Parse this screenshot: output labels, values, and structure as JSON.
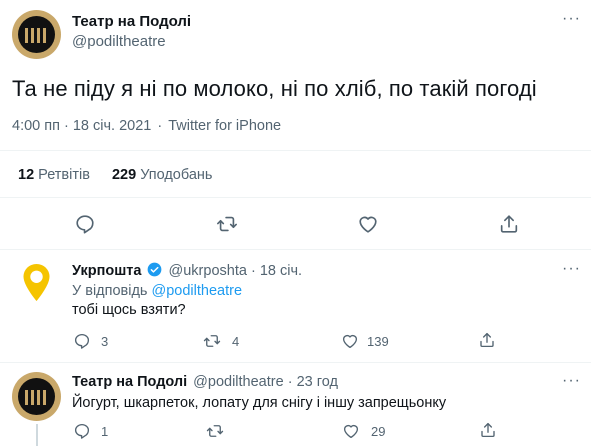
{
  "main_tweet": {
    "display_name": "Театр на Подолі",
    "handle": "@podiltheatre",
    "text": "Та не піду я ні по молоко, ні по хліб, по такій погоді",
    "timestamp": "4:00 пп · 18 січ. 2021",
    "separator": "·",
    "source": "Twitter for iPhone",
    "retweets_count": "12",
    "retweets_label": "Ретвітів",
    "likes_count": "229",
    "likes_label": "Уподобань",
    "more_icon": "more-dots-icon"
  },
  "reply_1": {
    "display_name": "Укрпошта",
    "handle": "@ukrposhta",
    "separator": "·",
    "time": "18 січ.",
    "reply_to_prefix": "У відповідь",
    "reply_to_handle": "@podiltheatre",
    "text": "тобі щось взяти?",
    "reply_count": "3",
    "retweet_count": "4",
    "like_count": "139",
    "verified": true
  },
  "reply_2": {
    "display_name": "Театр на Подолі",
    "handle": "@podiltheatre",
    "separator": "·",
    "time": "23 год",
    "text": "Йогурт, шкарпеток, лопату для снігу і іншу запрещьонку",
    "reply_count": "1",
    "retweet_count": "",
    "like_count": "29"
  },
  "colors": {
    "accent": "#1d9bf0",
    "text": "#0f1419",
    "muted": "#536471",
    "divider": "#eff3f4",
    "ukrposhta_yellow": "#f5c400"
  }
}
